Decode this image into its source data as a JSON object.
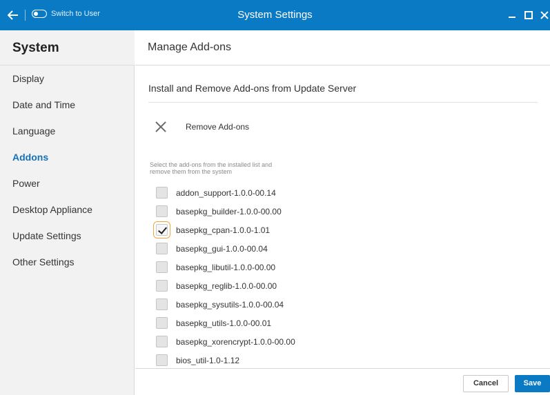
{
  "titlebar": {
    "back_icon": "arrow-left-icon",
    "switch_label": "Switch to User",
    "title": "System Settings",
    "controls": [
      "minimize-icon",
      "maximize-icon",
      "close-icon"
    ]
  },
  "sidebar": {
    "title": "System",
    "items": [
      {
        "label": "Display",
        "active": false
      },
      {
        "label": "Date and Time",
        "active": false
      },
      {
        "label": "Language",
        "active": false
      },
      {
        "label": "Addons",
        "active": true
      },
      {
        "label": "Power",
        "active": false
      },
      {
        "label": "Desktop Appliance",
        "active": false
      },
      {
        "label": "Update Settings",
        "active": false
      },
      {
        "label": "Other Settings",
        "active": false
      }
    ]
  },
  "main": {
    "header": "Manage Add-ons",
    "section_title": "Install and Remove Add-ons from Update Server",
    "remove": {
      "icon": "close-icon",
      "label": "Remove Add-ons"
    },
    "hint": "Select the add-ons from the installed list and remove them from the system",
    "addons": [
      {
        "label": "addon_support-1.0.0-00.14",
        "checked": false
      },
      {
        "label": "basepkg_builder-1.0.0-00.00",
        "checked": false
      },
      {
        "label": "basepkg_cpan-1.0.0-1.01",
        "checked": true
      },
      {
        "label": "basepkg_gui-1.0.0-00.04",
        "checked": false
      },
      {
        "label": "basepkg_libutil-1.0.0-00.00",
        "checked": false
      },
      {
        "label": "basepkg_reglib-1.0.0-00.00",
        "checked": false
      },
      {
        "label": "basepkg_sysutils-1.0.0-00.04",
        "checked": false
      },
      {
        "label": "basepkg_utils-1.0.0-00.01",
        "checked": false
      },
      {
        "label": "basepkg_xorencrypt-1.0.0-00.00",
        "checked": false
      },
      {
        "label": "bios_util-1.0-1.12",
        "checked": false
      }
    ]
  },
  "footer": {
    "cancel_label": "Cancel",
    "save_label": "Save"
  },
  "colors": {
    "accent": "#0a7ac4",
    "active_nav": "#1471b8",
    "focus_outline": "#f2a641"
  }
}
